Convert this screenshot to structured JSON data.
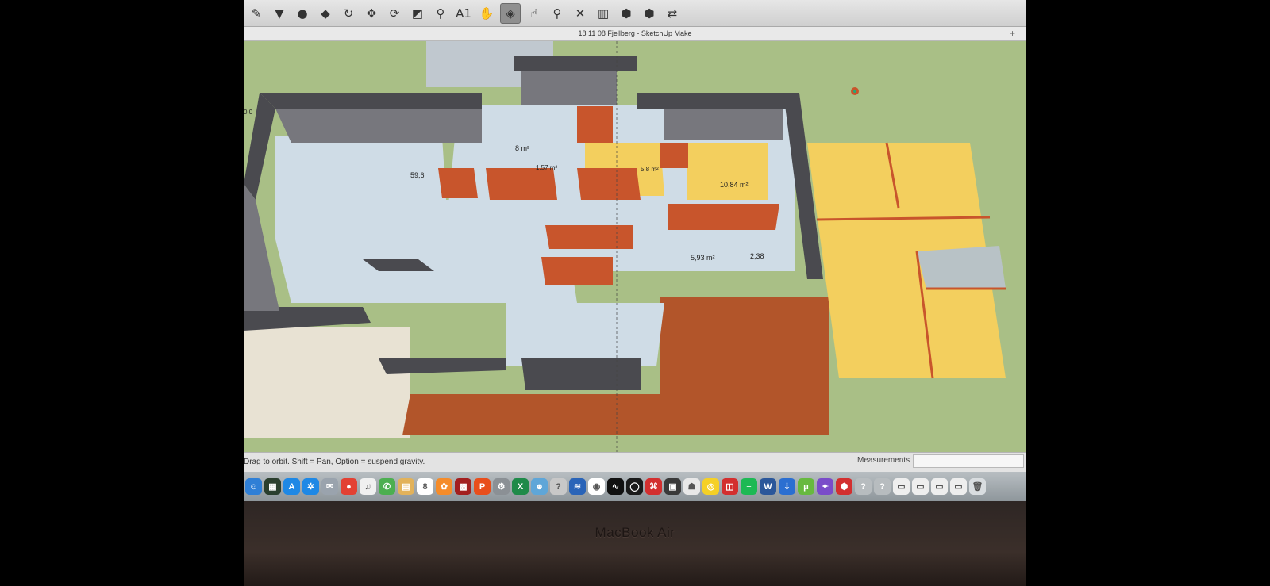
{
  "window": {
    "title": "18 11 08 Fjellberg - SketchUp Make",
    "plus": "+"
  },
  "toolbar": {
    "tools": [
      {
        "name": "pencil-tool",
        "glyph": "✎"
      },
      {
        "name": "paint-bucket-tool",
        "glyph": "▼"
      },
      {
        "name": "eraser-tool",
        "glyph": "●"
      },
      {
        "name": "push-pull-tool",
        "glyph": "◆"
      },
      {
        "name": "rotate-tool",
        "glyph": "↻"
      },
      {
        "name": "move-tool",
        "glyph": "✥"
      },
      {
        "name": "follow-me-tool",
        "glyph": "⟳"
      },
      {
        "name": "scale-tool",
        "glyph": "◩"
      },
      {
        "name": "tape-measure-tool",
        "glyph": "⚲"
      },
      {
        "name": "text-tool",
        "glyph": "A1"
      },
      {
        "name": "walk-tool",
        "glyph": "✋"
      },
      {
        "name": "orbit-tool",
        "glyph": "◈",
        "active": true
      },
      {
        "name": "pan-tool",
        "glyph": "☝"
      },
      {
        "name": "zoom-tool",
        "glyph": "⚲"
      },
      {
        "name": "zoom-extents-tool",
        "glyph": "✕"
      },
      {
        "name": "section-plane-tool",
        "glyph": "▥"
      },
      {
        "name": "warehouse-tool",
        "glyph": "⬢"
      },
      {
        "name": "extension-tool",
        "glyph": "⬢"
      },
      {
        "name": "send-to-layout-tool",
        "glyph": "⇄"
      }
    ]
  },
  "model": {
    "area_labels": [
      "59,6",
      "8 m²",
      "1,57 m²",
      "5,8 m²",
      "10,84 m²",
      "5,93 m²",
      "2,38"
    ],
    "corner_label": "0,0",
    "colors": {
      "ground": "#a9bf86",
      "floor": "#cfdce6",
      "wall_top": "#4a4a4f",
      "wall_side": "#77777d",
      "brick": "#c8552c",
      "deck": "#b2552a",
      "yellow": "#f3cf5e"
    }
  },
  "status": {
    "hint": "Drag to orbit. Shift = Pan, Option = suspend gravity.",
    "measurements_label": "Measurements",
    "measurements_value": ""
  },
  "dock": {
    "apps": [
      {
        "name": "finder-icon",
        "color": "#2f7fd6",
        "glyph": "☺"
      },
      {
        "name": "mission-control-icon",
        "color": "#2b3f2e",
        "glyph": "▦"
      },
      {
        "name": "app-store-icon",
        "color": "#1e88e5",
        "glyph": "A"
      },
      {
        "name": "safari-icon",
        "color": "#1e88e5",
        "glyph": "✲"
      },
      {
        "name": "mail-badge-icon",
        "color": "#9aa3ad",
        "glyph": "✉"
      },
      {
        "name": "chrome-icon",
        "color": "#e34133",
        "glyph": "●"
      },
      {
        "name": "itunes-icon",
        "color": "#f0f0f0",
        "glyph": "♫"
      },
      {
        "name": "messages-icon",
        "color": "#4caf50",
        "glyph": "✆"
      },
      {
        "name": "notes-icon",
        "color": "#e2b25a",
        "glyph": "▤"
      },
      {
        "name": "calendar-icon",
        "color": "#ffffff",
        "glyph": "8"
      },
      {
        "name": "photos-icon",
        "color": "#f58c2a",
        "glyph": "✿"
      },
      {
        "name": "photo-booth-icon",
        "color": "#a31f1f",
        "glyph": "▩"
      },
      {
        "name": "pages-icon",
        "color": "#e84e1c",
        "glyph": "P"
      },
      {
        "name": "system-preferences-icon",
        "color": "#8b9095",
        "glyph": "⚙"
      },
      {
        "name": "excel-icon",
        "color": "#1f8a49",
        "glyph": "X"
      },
      {
        "name": "contacts-icon",
        "color": "#5fa6d8",
        "glyph": "☻"
      },
      {
        "name": "help-icon",
        "color": "#c8c8c8",
        "glyph": "?"
      },
      {
        "name": "airdrop-icon",
        "color": "#2a64b8",
        "glyph": "≋"
      },
      {
        "name": "color-picker-icon",
        "color": "#ffffff",
        "glyph": "◉"
      },
      {
        "name": "script-icon",
        "color": "#111111",
        "glyph": "∿"
      },
      {
        "name": "activity-icon",
        "color": "#1a1a1a",
        "glyph": "◯"
      },
      {
        "name": "pdf-icon",
        "color": "#d32f2f",
        "glyph": "⌘"
      },
      {
        "name": "calendar2-icon",
        "color": "#3a3a3a",
        "glyph": "▣"
      },
      {
        "name": "preview-icon",
        "color": "#e8e8e8",
        "glyph": "☗"
      },
      {
        "name": "sticky-icon",
        "color": "#f5d026",
        "glyph": "◎"
      },
      {
        "name": "gallery-icon",
        "color": "#d32f2f",
        "glyph": "◫"
      },
      {
        "name": "spotify-icon",
        "color": "#1db954",
        "glyph": "≡"
      },
      {
        "name": "word-icon",
        "color": "#2b579a",
        "glyph": "W"
      },
      {
        "name": "transmit-icon",
        "color": "#2b6fd1",
        "glyph": "⇣"
      },
      {
        "name": "utorrent-icon",
        "color": "#67b93f",
        "glyph": "μ"
      },
      {
        "name": "launchpad-icon",
        "color": "#7a4cc9",
        "glyph": "✦"
      },
      {
        "name": "sketchup-icon",
        "color": "#d32f2f",
        "glyph": "⬢"
      },
      {
        "name": "unknown-app-icon",
        "color": "#b7bcbf",
        "glyph": "?"
      },
      {
        "name": "unknown-app-2-icon",
        "color": "#b7bcbf",
        "glyph": "?"
      },
      {
        "name": "document-icon",
        "color": "#eeeeee",
        "glyph": "▭"
      },
      {
        "name": "document-2-icon",
        "color": "#eeeeee",
        "glyph": "▭"
      },
      {
        "name": "document-3-icon",
        "color": "#eeeeee",
        "glyph": "▭"
      },
      {
        "name": "document-4-icon",
        "color": "#eeeeee",
        "glyph": "▭"
      },
      {
        "name": "trash-icon",
        "color": "#d9dde0",
        "glyph": "🗑"
      }
    ]
  },
  "device": {
    "brand": "MacBook Air"
  }
}
